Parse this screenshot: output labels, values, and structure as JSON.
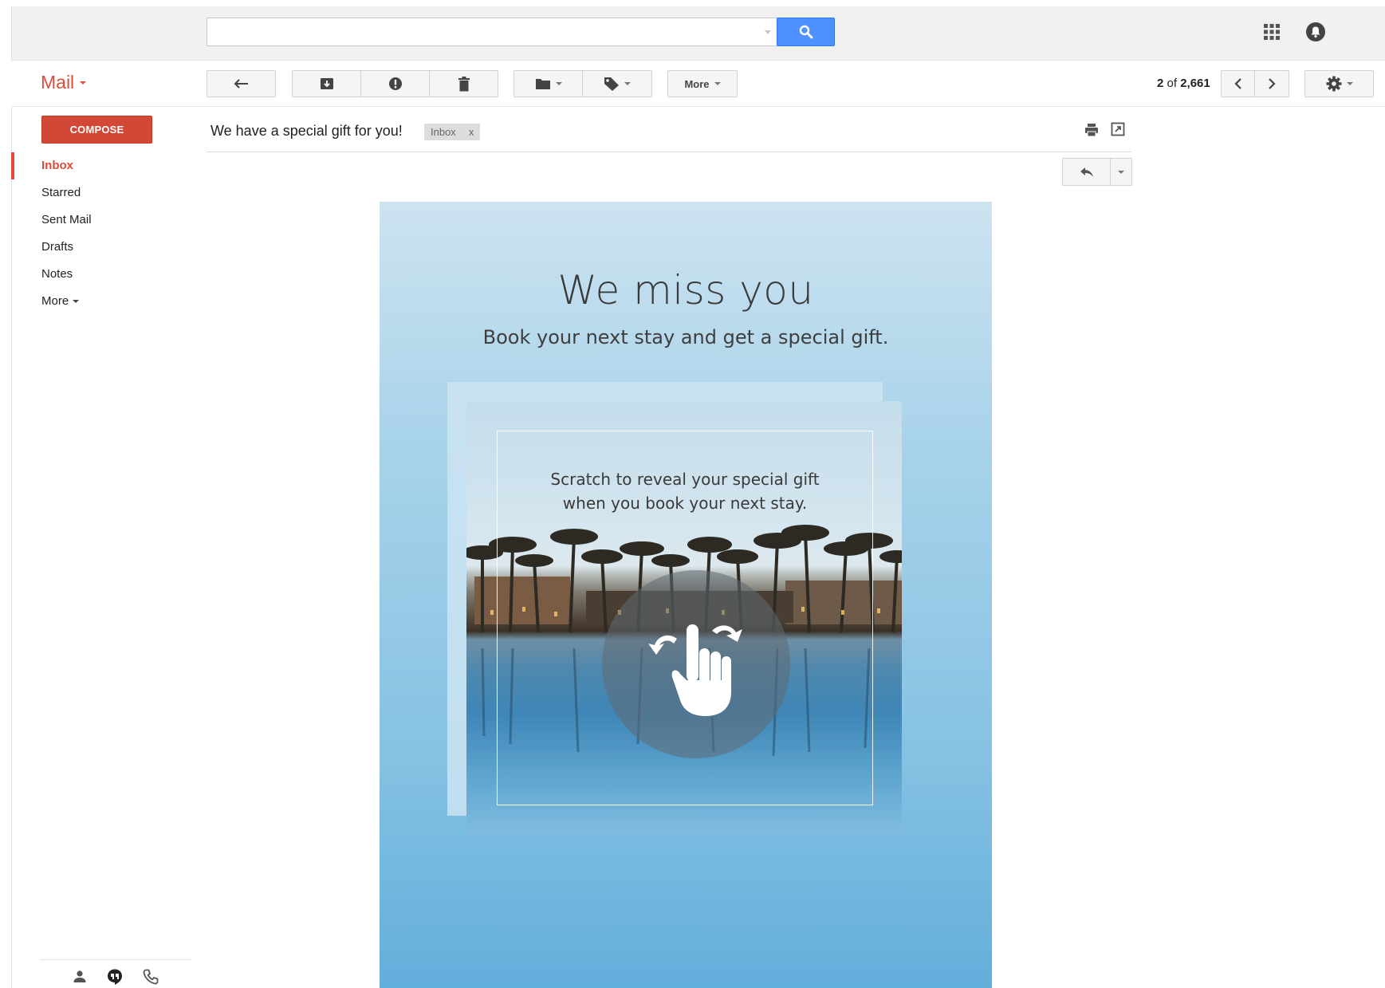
{
  "header": {
    "search": {
      "value": "",
      "placeholder": ""
    },
    "icons": {
      "search": "search-icon",
      "apps": "apps-grid-icon",
      "notifications": "notifications-icon"
    }
  },
  "toolbar": {
    "mail_menu_label": "Mail",
    "more_label": "More",
    "pagination": {
      "current": "2",
      "separator": "of",
      "total": "2,661"
    },
    "icons": {
      "back": "back-arrow-icon",
      "archive": "archive-icon",
      "spam": "report-spam-icon",
      "delete": "trash-icon",
      "move": "folder-icon",
      "labels": "label-tag-icon",
      "newer": "chevron-left-icon",
      "older": "chevron-right-icon",
      "settings": "gear-icon"
    }
  },
  "sidebar": {
    "compose_label": "COMPOSE",
    "items": [
      {
        "label": "Inbox",
        "active": true
      },
      {
        "label": "Starred"
      },
      {
        "label": "Sent Mail"
      },
      {
        "label": "Drafts"
      },
      {
        "label": "Notes"
      },
      {
        "label": "More"
      }
    ],
    "bottom_icons": [
      "contacts-icon",
      "hangouts-icon",
      "phone-icon"
    ]
  },
  "message": {
    "subject": "We have a special gift for you!",
    "label_chip": {
      "label": "Inbox",
      "remove": "x"
    },
    "icons": {
      "print": "print-icon",
      "new_window": "open-new-window-icon",
      "reply": "reply-icon",
      "reply_more": "caret-down-icon"
    }
  },
  "email": {
    "headline": "We miss you",
    "subheadline": "Book your next stay and get a special gift.",
    "scratch_line1": "Scratch to reveal your special gift",
    "scratch_line2": "when you book your next stay.",
    "image_description_icon": "scratch-hand-gesture-icon"
  },
  "colors": {
    "brand_red": "#dd4b39",
    "compose_red": "#d14836",
    "search_blue": "#4d90fe",
    "email_bg_top": "#cde3f0",
    "email_bg_bottom": "#62aedb"
  }
}
